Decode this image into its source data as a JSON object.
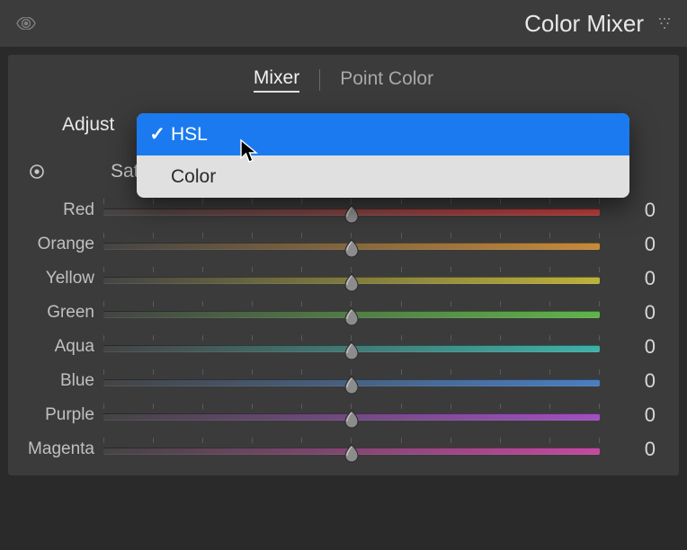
{
  "panel": {
    "title": "Color Mixer"
  },
  "tabs": {
    "mixer": "Mixer",
    "point_color": "Point Color"
  },
  "adjust": {
    "label": "Adjust"
  },
  "dropdown": {
    "options": [
      {
        "label": "HSL",
        "selected": true
      },
      {
        "label": "Color",
        "selected": false
      }
    ]
  },
  "section": {
    "label": "Saturation"
  },
  "sliders": [
    {
      "label": "Red",
      "value": "0",
      "grad": "grad-red"
    },
    {
      "label": "Orange",
      "value": "0",
      "grad": "grad-orange"
    },
    {
      "label": "Yellow",
      "value": "0",
      "grad": "grad-yellow"
    },
    {
      "label": "Green",
      "value": "0",
      "grad": "grad-green"
    },
    {
      "label": "Aqua",
      "value": "0",
      "grad": "grad-aqua"
    },
    {
      "label": "Blue",
      "value": "0",
      "grad": "grad-blue"
    },
    {
      "label": "Purple",
      "value": "0",
      "grad": "grad-purple"
    },
    {
      "label": "Magenta",
      "value": "0",
      "grad": "grad-magenta"
    }
  ]
}
